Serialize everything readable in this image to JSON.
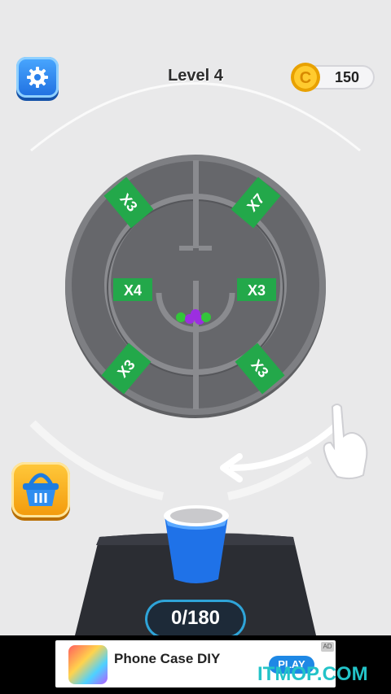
{
  "header": {
    "level_title": "Level 4",
    "coins": "150"
  },
  "board": {
    "multipliers": {
      "outer_top_left": "X3",
      "outer_top_right": "X7",
      "inner_left": "X4",
      "inner_right": "X3",
      "outer_bottom_left": "X3",
      "outer_bottom_right": "X3"
    }
  },
  "counter": {
    "value": "0/180"
  },
  "ad": {
    "title": "Phone Case DIY",
    "cta": "PLAY",
    "badge": "AD"
  },
  "watermark": "ITMOP.COM",
  "icons": {
    "settings": "gear-icon",
    "coin": "coin-icon",
    "basket": "basket-icon",
    "hand": "pointing-hand-icon",
    "arrow": "swipe-arrow-icon"
  }
}
